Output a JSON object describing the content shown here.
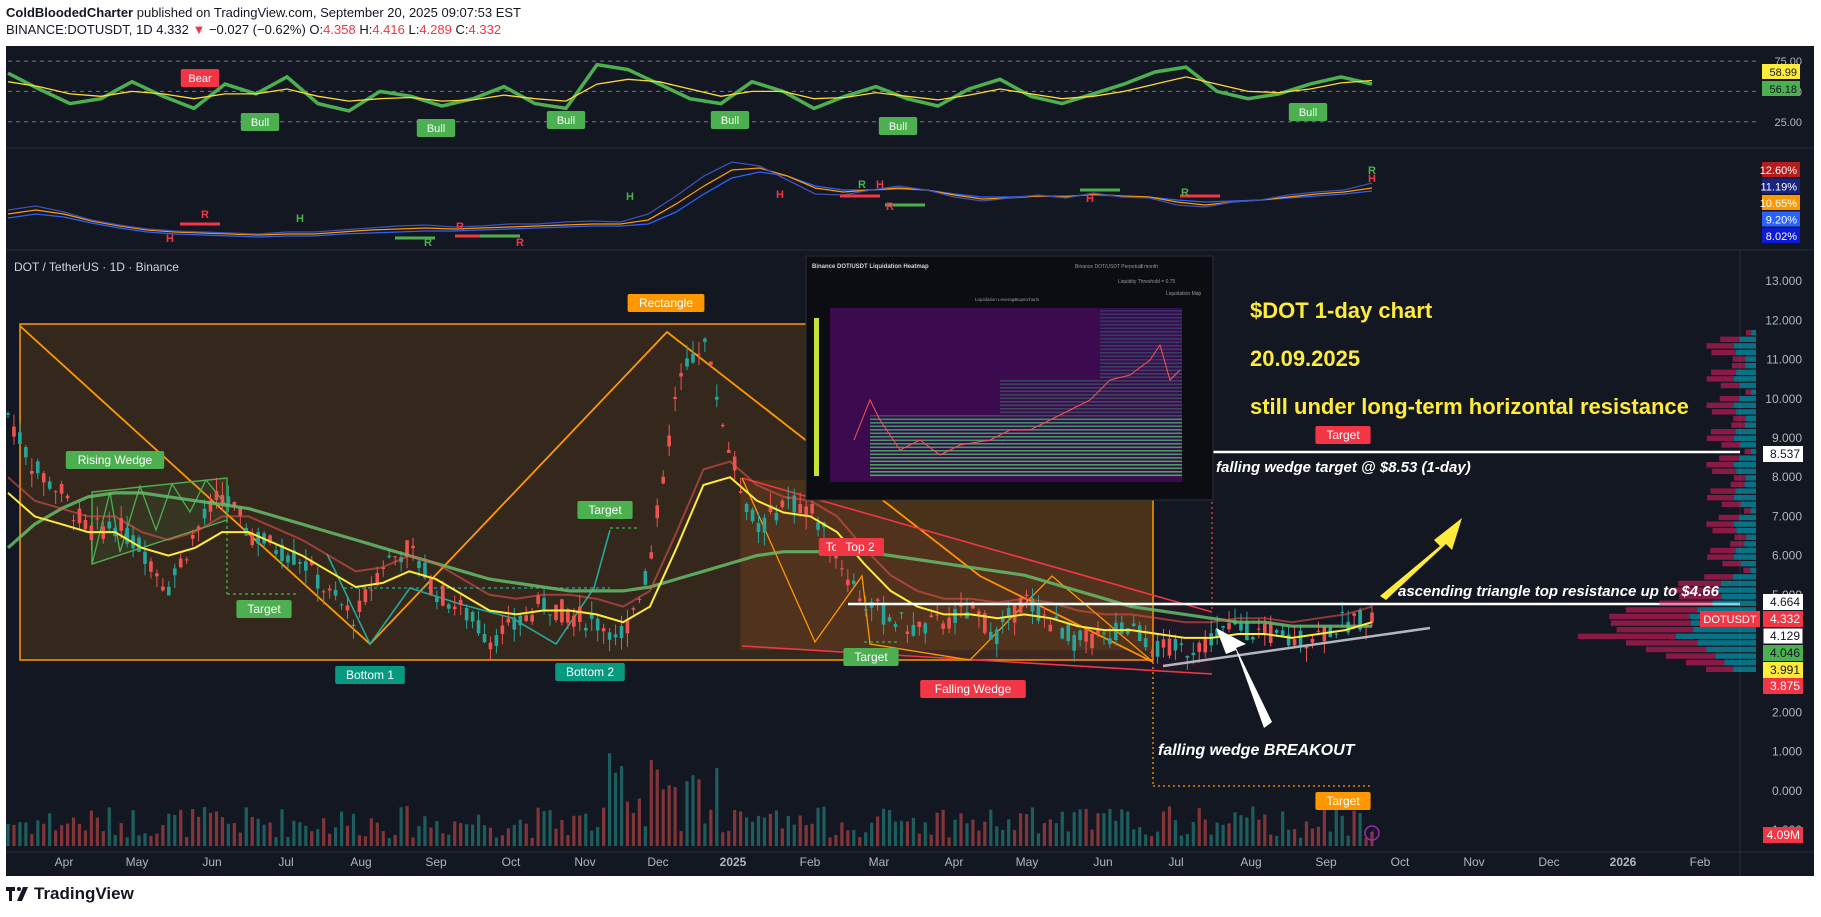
{
  "header": {
    "author": "ColdBloodedCharter",
    "published": "published on TradingView.com, September 20, 2025 09:07:53 EST",
    "symbol": "BINANCE:DOTUSDT, 1D",
    "last": "4.332",
    "change": "−0.027 (−0.62%)",
    "o_label": "O:",
    "o": "4.358",
    "h_label": "H:",
    "h": "4.416",
    "l_label": "L:",
    "l": "4.289",
    "c_label": "C:",
    "c": "4.332"
  },
  "main_title": "DOT / TetherUS · 1D · Binance",
  "footer_brand": "TradingView",
  "colors": {
    "background": "#131722",
    "up": "#26a69a",
    "down": "#ef5350",
    "orange": "#ff9800",
    "yellow": "#ffeb3b",
    "green": "#4caf50",
    "red": "#f23645",
    "teal": "#089981",
    "white": "#ffffff"
  },
  "annotation": {
    "title": "$DOT  1-day chart",
    "date": "20.09.2025",
    "note": "still under long-term horizontal resistance",
    "fw_target": "falling wedge target @ $8.53 (1-day)",
    "asc_triangle": "ascending triangle top resistance  up to $4.66",
    "breakout": "falling wedge BREAKOUT"
  },
  "chart_data": [
    {
      "type": "line",
      "name": "RSI panel",
      "levels": [
        75,
        50,
        25
      ],
      "series": [
        {
          "name": "",
          "values": [
            65,
            52,
            40,
            44,
            58,
            46,
            36,
            56,
            48,
            62,
            40,
            34,
            50,
            46,
            38,
            44,
            54,
            40,
            36,
            72,
            68,
            56,
            44,
            40,
            58,
            50,
            36,
            46,
            54,
            44,
            38,
            52,
            60,
            46,
            40,
            48,
            56,
            66,
            70,
            50,
            44,
            48,
            56,
            62,
            56
          ]
        },
        {
          "name": "",
          "values": [
            58,
            54,
            48,
            46,
            50,
            48,
            44,
            48,
            48,
            52,
            46,
            42,
            44,
            45,
            42,
            43,
            47,
            44,
            42,
            56,
            60,
            58,
            52,
            46,
            50,
            50,
            44,
            45,
            49,
            46,
            43,
            47,
            52,
            48,
            44,
            46,
            50,
            56,
            62,
            56,
            50,
            49,
            52,
            57,
            59
          ]
        }
      ],
      "labels": [
        "Bear",
        "Bull",
        "Bull",
        "Bull",
        "Bull",
        "Bull",
        "Bull"
      ],
      "scale_labels": [
        "75.00",
        "50.00",
        "25.00"
      ],
      "badges": [
        "58.99",
        "56.18"
      ]
    },
    {
      "type": "line",
      "name": "Volatility panel",
      "marks": [
        "R",
        "H",
        "H",
        "R",
        "R",
        "H",
        "R",
        "R",
        "H",
        "R",
        "H",
        "R",
        "H",
        "R",
        "H"
      ],
      "badges": [
        "12.60%",
        "11.19%",
        "10.65%",
        "9.20%",
        "8.02%"
      ]
    },
    {
      "type": "line",
      "title": "DOT / TetherUS · 1D · Binance",
      "x_ticks": [
        "Apr",
        "May",
        "Jun",
        "Jul",
        "Aug",
        "Sep",
        "Oct",
        "Nov",
        "Dec",
        "2025",
        "Feb",
        "Mar",
        "Apr",
        "May",
        "Jun",
        "Jul",
        "Aug",
        "Sep",
        "Oct",
        "Nov",
        "Dec",
        "2026",
        "Feb"
      ],
      "y_ticks": [
        "13.000",
        "12.000",
        "11.000",
        "10.000",
        "9.000",
        "8.000",
        "7.000",
        "6.000",
        "5.000",
        "4.000",
        "3.000",
        "2.000",
        "1.000",
        "0.000",
        "−1.000"
      ],
      "ylim": [
        -1,
        13
      ],
      "series": [
        {
          "name": "",
          "values": [
            9.6,
            8.2,
            7.6,
            6.6,
            6.8,
            6.2,
            5.2,
            6.6,
            7.6,
            6.6,
            6.2,
            5.9,
            5.0,
            4.4,
            5.8,
            6.2,
            5.1,
            4.6,
            3.9,
            4.2,
            4.8,
            4.5,
            4.3,
            4.0,
            5.8,
            10.2,
            11.6,
            8.6,
            6.6,
            7.4,
            7.2,
            6.0,
            4.8,
            4.4,
            4.1,
            4.3,
            4.6,
            4.0,
            4.9,
            4.3,
            3.8,
            3.9,
            4.2,
            3.6,
            3.6,
            3.9,
            4.2,
            4.0,
            3.8,
            4.0,
            4.3,
            4.5
          ]
        },
        {
          "name": "",
          "values": [
            7.6,
            7.0,
            6.8,
            6.6,
            6.6,
            6.2,
            6.0,
            6.2,
            6.6,
            6.6,
            6.3,
            6.0,
            5.6,
            5.2,
            5.3,
            5.6,
            5.4,
            5.0,
            4.6,
            4.5,
            4.6,
            4.6,
            4.5,
            4.3,
            4.7,
            6.2,
            7.8,
            8.0,
            7.4,
            7.1,
            7.0,
            6.6,
            5.8,
            5.1,
            4.7,
            4.5,
            4.5,
            4.4,
            4.5,
            4.4,
            4.2,
            4.1,
            4.1,
            4.0,
            3.9,
            3.9,
            4.0,
            4.0,
            3.9,
            4.0,
            4.1,
            4.3
          ]
        },
        {
          "name": "",
          "values": [
            6.2,
            6.8,
            7.2,
            7.5,
            7.6,
            7.6,
            7.5,
            7.4,
            7.3,
            7.2,
            7.0,
            6.8,
            6.6,
            6.4,
            6.2,
            6.0,
            5.8,
            5.6,
            5.4,
            5.3,
            5.2,
            5.1,
            5.1,
            5.1,
            5.2,
            5.4,
            5.6,
            5.8,
            6.0,
            6.1,
            6.1,
            6.1,
            6.1,
            6.0,
            5.9,
            5.8,
            5.7,
            5.6,
            5.5,
            5.3,
            5.1,
            4.9,
            4.7,
            4.6,
            4.5,
            4.4,
            4.3,
            4.3,
            4.2,
            4.2,
            4.2,
            4.2
          ]
        }
      ],
      "patterns": [
        "Rectangle",
        "Rising Wedge",
        "Target",
        "Bottom 1",
        "Bottom 2",
        "Target",
        "To",
        "Top 2",
        "Target",
        "Falling Wedge",
        "Target",
        "Target"
      ],
      "levels": [
        8.537,
        4.664
      ],
      "price_badges": [
        "8.537",
        "4.664",
        "4.332",
        "4.129",
        "4.046",
        "3.991",
        "3.875",
        "4.09M"
      ],
      "symbol_badge": "DOTUSDT"
    }
  ],
  "inset": {
    "title": "Binance DOT/USDT Liquidation Heatmap",
    "controls": [
      "Binance DOT/USDT Perpetual",
      "1 month"
    ],
    "slider_label": "Liquidity Threshold = 0.75",
    "checkbox_label": "Liquidation Map",
    "legend": [
      "Liquidation Leverage",
      "Supercharts"
    ]
  }
}
